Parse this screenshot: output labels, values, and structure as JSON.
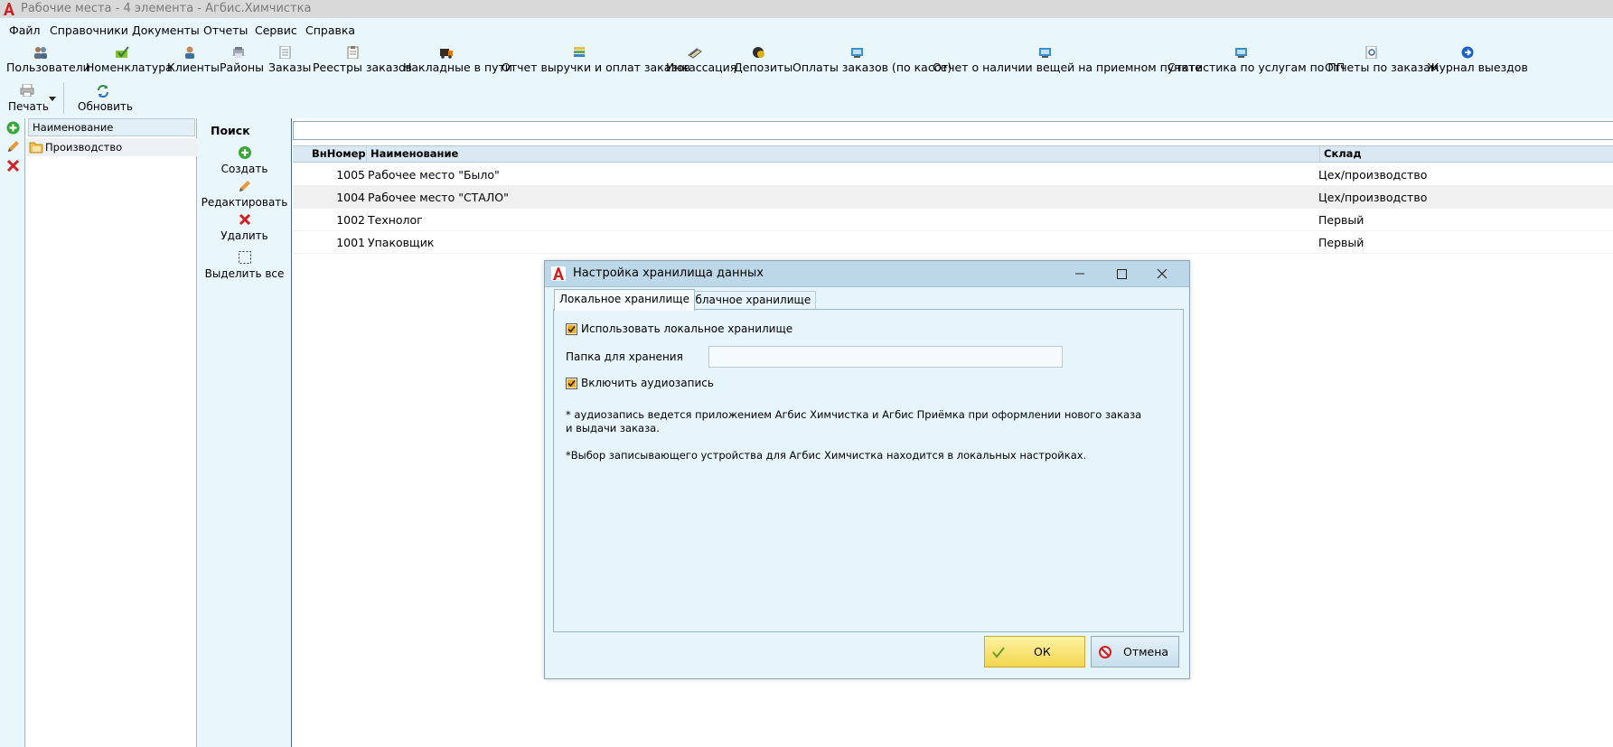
{
  "window": {
    "title": "Рабочие места - 4 элемента - Агбис.Химчистка"
  },
  "menu": [
    "Файл",
    "Справочники",
    "Документы",
    "Отчеты",
    "Сервис",
    "Справка"
  ],
  "toolbar": [
    {
      "label": "Пользователи",
      "icon": "users-icon"
    },
    {
      "label": "Номенклатура",
      "icon": "nomenclature-icon"
    },
    {
      "label": "Клиенты",
      "icon": "clients-icon"
    },
    {
      "label": "Районы",
      "icon": "districts-icon"
    },
    {
      "label": "Заказы",
      "icon": "orders-icon"
    },
    {
      "label": "Реестры заказов",
      "icon": "order-registers-icon"
    },
    {
      "label": "Накладные в пути",
      "icon": "waybills-icon"
    },
    {
      "label": "Отчет выручки и оплат заказов",
      "icon": "revenue-report-icon"
    },
    {
      "label": "Инкассация",
      "icon": "collection-icon"
    },
    {
      "label": "Депозиты",
      "icon": "deposits-icon"
    },
    {
      "label": "Оплаты заказов (по кассе)",
      "icon": "cash-payments-icon"
    },
    {
      "label": "Отчет о наличии вещей на приемном пункте",
      "icon": "items-report-icon"
    },
    {
      "label": "Статистика по услугам по ПП",
      "icon": "service-stats-icon"
    },
    {
      "label": "Отчеты по заказам",
      "icon": "order-reports-icon"
    },
    {
      "label": "Журнал выездов",
      "icon": "trips-journal-icon"
    }
  ],
  "toolbar2": {
    "print": "Печать",
    "refresh": "Обновить"
  },
  "tree": {
    "header": "Наименование",
    "items": [
      "Производство"
    ]
  },
  "actions": {
    "search": "Поиск",
    "create": "Создать",
    "edit": "Редактировать",
    "delete": "Удалить",
    "select_all": "Выделить все"
  },
  "grid": {
    "columns": [
      "ВнНомер",
      "Наименование",
      "Склад"
    ],
    "rows": [
      {
        "num": "1005",
        "name": "Рабочее место \"Было\"",
        "store": "Цех/производство"
      },
      {
        "num": "1004",
        "name": "Рабочее место \"СТАЛО\"",
        "store": "Цех/производство"
      },
      {
        "num": "1002",
        "name": "Технолог",
        "store": "Первый"
      },
      {
        "num": "1001",
        "name": "Упаковщик",
        "store": "Первый"
      }
    ]
  },
  "dialog": {
    "title": "Настройка хранилища данных",
    "tabs": [
      "Локальное хранилище",
      "Облачное хранилище"
    ],
    "use_local": {
      "label": "Использовать локальное хранилище",
      "checked": true
    },
    "folder_label": "Папка для хранения",
    "folder_value": "",
    "audio": {
      "label": "Включить аудиозапись",
      "checked": true
    },
    "note1_line1": "* аудиозапись ведется приложением Агбис Химчистка и Агбис Приёмка при оформлении нового заказа",
    "note1_line2": "и выдачи заказа.",
    "note2": "*Выбор записывающего устройства для Агбис Химчистка находится в локальных настройках.",
    "ok": "ОК",
    "cancel": "Отмена"
  },
  "colors": {
    "background": "#e9f6fc",
    "titlebar": "#d9d9d9",
    "ok_button": "#f3d54e",
    "delete_red": "#d21e1e",
    "add_green": "#3aa63a"
  }
}
